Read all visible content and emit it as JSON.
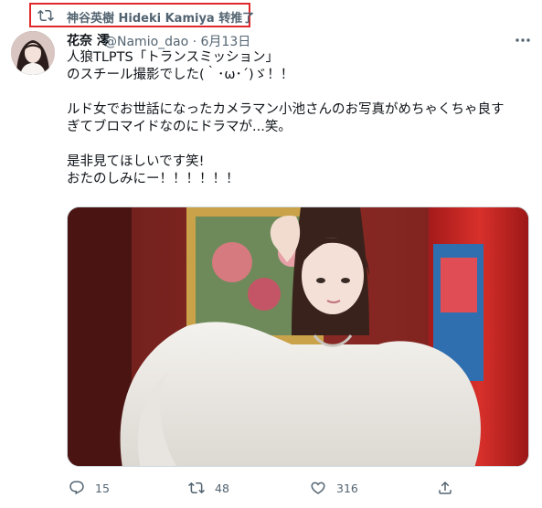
{
  "retweet": {
    "icon": "retweet-icon",
    "text": "神谷英樹 Hideki Kamiya 转推了"
  },
  "tweet": {
    "author_name": "花奈 澪",
    "author_handle_date": "@Namio_dao · 6月13日",
    "lines": [
      "人狼TLPTS「トランスミッション」",
      "のスチール撮影でした(｀･ω･´)ゞ！！",
      "",
      "ルド女でお世話になったカメラマン小池さんのお写真がめちゃくちゃ良す",
      "ぎてブロマイドなのにドラマが...笑。",
      "",
      "是非見てほしいです笑!",
      "おたのしみにー！！！！！！"
    ]
  },
  "actions": {
    "reply_count": "15",
    "retweet_count": "48",
    "like_count": "316"
  },
  "colors": {
    "highlight_border": "#e0282a",
    "secondary_text": "#536471",
    "primary_text": "#0f1419"
  }
}
